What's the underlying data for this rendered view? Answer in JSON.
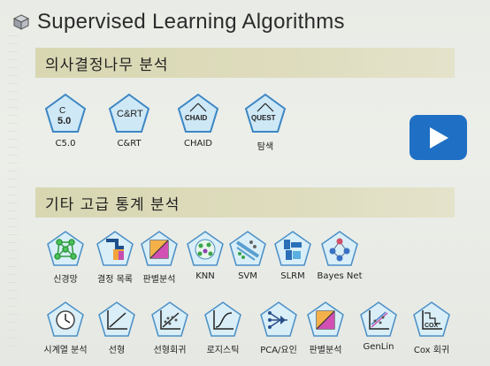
{
  "header": {
    "title": "Supervised Learning Algorithms",
    "icon": "cube-icon"
  },
  "sections": [
    {
      "label": "의사결정나무 분석"
    },
    {
      "label": "기타 고급 통계 분석"
    }
  ],
  "tree_nodes": [
    {
      "label": "C5.0",
      "icon_text": "C\n5.0"
    },
    {
      "label": "C&RT",
      "icon_text": "C&RT"
    },
    {
      "label": "CHAID",
      "icon_text": "CHAID"
    },
    {
      "label": "탐색",
      "icon_text": "QUEST"
    }
  ],
  "adv_row1": [
    {
      "label": "신경망"
    },
    {
      "label": "결정 목록"
    },
    {
      "label": "판별분석"
    },
    {
      "label": "KNN"
    },
    {
      "label": "SVM"
    },
    {
      "label": "SLRM"
    },
    {
      "label": "Bayes Net"
    }
  ],
  "adv_row2": [
    {
      "label": "시계열 분석"
    },
    {
      "label": "선형"
    },
    {
      "label": "선형회귀"
    },
    {
      "label": "로지스틱"
    },
    {
      "label": "PCA/요인"
    },
    {
      "label": "판별분석"
    },
    {
      "label": "GenLin"
    },
    {
      "label": "Cox 회귀",
      "icon_text": "COX"
    }
  ],
  "player": {
    "play_icon": "play-icon",
    "color": "#1f6fc4"
  }
}
